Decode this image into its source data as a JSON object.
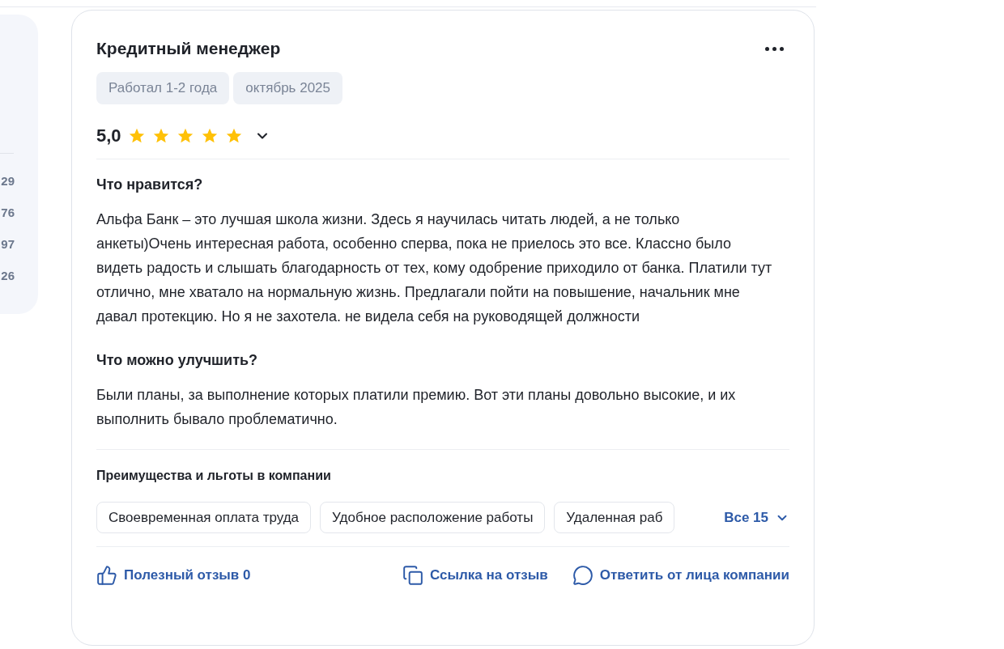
{
  "side_panel": {
    "numbers": [
      "29",
      "76",
      "97",
      "26"
    ]
  },
  "review": {
    "title": "Кредитный менеджер",
    "tags": [
      "Работал 1-2 года",
      "октябрь 2025"
    ],
    "rating": {
      "value": "5,0",
      "stars": 5,
      "expanded": false
    },
    "sections": [
      {
        "heading": "Что нравится?",
        "text": "Альфа Банк – это лучшая школа жизни. Здесь я научилась читать людей, а не только анкеты)Очень интересная работа, особенно сперва, пока не приелось это все. Классно было видеть радость и слышать благодарность от тех, кому одобрение приходило от банка. Платили тут отлично, мне хватало на нормальную жизнь. Предлагали пойти на повышение, начальник мне давал протекцию. Но я не захотела. не видела себя на руководящей должности"
      },
      {
        "heading": "Что можно улучшить?",
        "text": "Были планы, за выполнение которых платили премию. Вот эти планы довольно высокие, и их выполнить бывало проблематично."
      }
    ],
    "benefits": {
      "heading": "Преимущества и льготы в компании",
      "items": [
        "Своевременная оплата труда",
        "Удобное расположение работы",
        "Удаленная раб"
      ],
      "all_label": "Все 15"
    },
    "actions": [
      {
        "kind": "like",
        "label": "Полезный отзыв 0"
      },
      {
        "kind": "link",
        "label": "Ссылка на отзыв"
      },
      {
        "kind": "reply",
        "label": "Ответить от лица компании"
      }
    ]
  }
}
